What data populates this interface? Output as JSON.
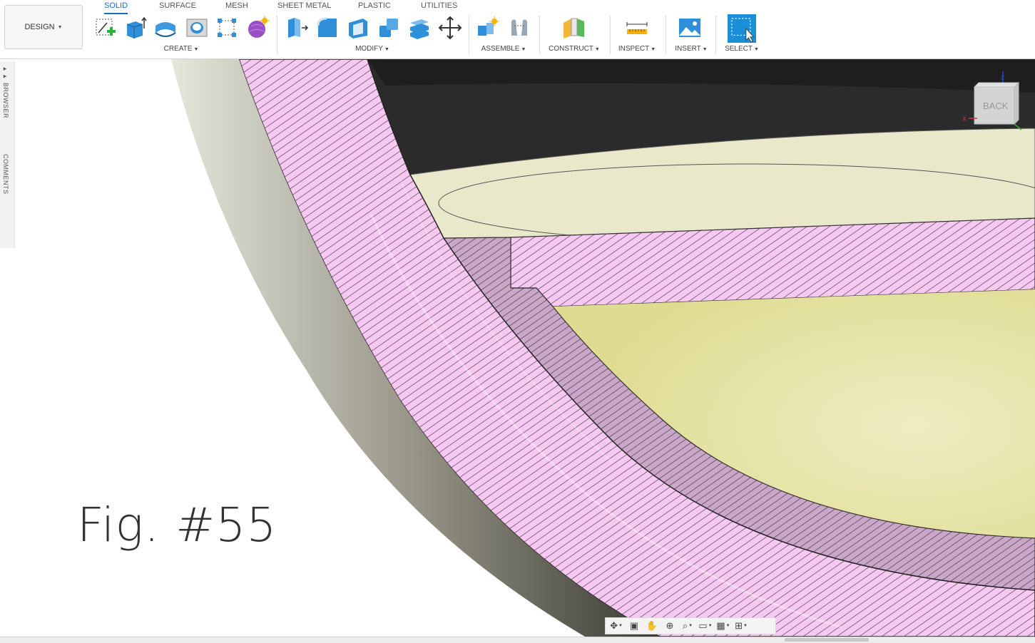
{
  "workspace": {
    "label": "DESIGN"
  },
  "tabs": [
    {
      "label": "SOLID",
      "active": true
    },
    {
      "label": "SURFACE",
      "active": false
    },
    {
      "label": "MESH",
      "active": false
    },
    {
      "label": "SHEET METAL",
      "active": false
    },
    {
      "label": "PLASTIC",
      "active": false
    },
    {
      "label": "UTILITIES",
      "active": false
    }
  ],
  "groups": {
    "create": "CREATE",
    "modify": "MODIFY",
    "assemble": "ASSEMBLE",
    "construct": "CONSTRUCT",
    "inspect": "INSPECT",
    "insert": "INSERT",
    "select": "SELECT"
  },
  "side_panel": {
    "browser": "BROWSER",
    "comments": "COMMENTS"
  },
  "figure": {
    "label": "Fig.  #55"
  },
  "viewcube": {
    "face": "BACK",
    "axis_x": "X",
    "axis_z": "Z"
  },
  "colors": {
    "accent": "#1b6fc2",
    "section_pink": "#f6c6f0",
    "section_dark": "#c9a8c6",
    "surface_cream": "#e9e8c8",
    "surface_yellow": "#e4e29c",
    "shell_dark": "#2a2a2a"
  },
  "icons": {
    "create": [
      "sketch-icon",
      "extrude-icon",
      "revolve-icon",
      "hole-icon",
      "pattern-icon",
      "form-icon"
    ],
    "modify": [
      "press-pull-icon",
      "fillet-icon",
      "shell-icon",
      "combine-icon",
      "split-icon",
      "move-icon"
    ],
    "nav": [
      "orbit-icon",
      "look-at-icon",
      "pan-icon",
      "zoom-icon",
      "fit-icon",
      "display-icon",
      "grid-icon",
      "viewports-icon"
    ]
  }
}
